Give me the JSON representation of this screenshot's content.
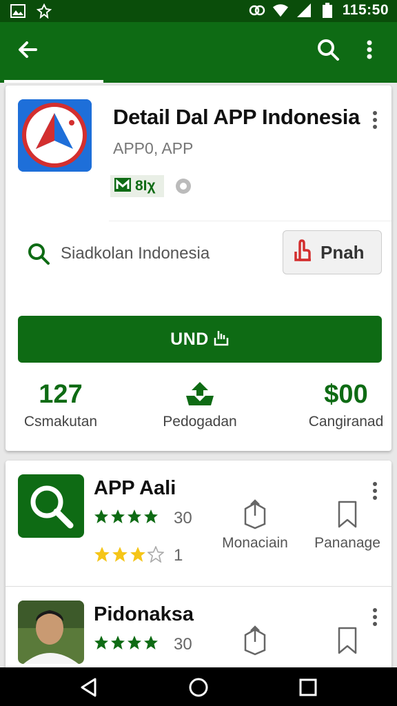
{
  "status_bar": {
    "time": "115:50",
    "icons": [
      "image-icon",
      "notification-icon",
      "sync-icon",
      "wifi-icon",
      "signal-icon",
      "battery-icon"
    ]
  },
  "app_bar": {
    "icons": [
      "back-arrow-icon",
      "search-icon",
      "more-vert-icon"
    ]
  },
  "app_detail": {
    "title": "Detail Dal APP Indonesia",
    "subtitle": "APP0, APP",
    "badge_text": "8Iχ",
    "search_text": "Siadkolan Indonesia",
    "pin_button_label": "Pnah",
    "install_button_label": "UND",
    "stats": [
      {
        "value": "127",
        "label": "Csmakutan"
      },
      {
        "value": "",
        "label": "Pedogadan"
      },
      {
        "value": "$00",
        "label": "Cangiranad"
      }
    ]
  },
  "related_apps": [
    {
      "title": "APP Aali",
      "rating_count": "30",
      "secondary_count": "1",
      "actions": [
        "Monaciain",
        "Pananage"
      ]
    },
    {
      "title": "Pidonaksa",
      "rating_count": "30",
      "actions": [
        "",
        ""
      ]
    }
  ],
  "colors": {
    "primary": "#0e6b14",
    "status_bar": "#0a4d0a",
    "star_green": "#0e6b14",
    "star_yellow": "#f5c518"
  }
}
